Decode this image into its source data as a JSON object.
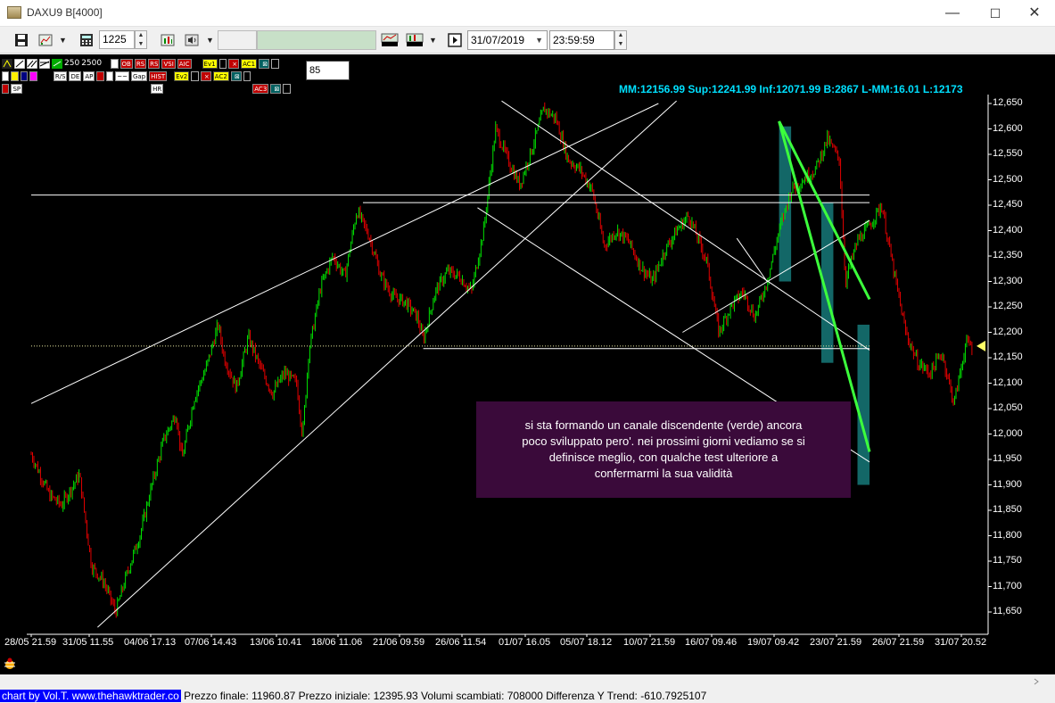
{
  "window": {
    "title": "DAXU9 B[4000]",
    "min_glyph": "—",
    "max_glyph": "☐",
    "close_glyph": "✕"
  },
  "toolbar": {
    "bars_value": "1225",
    "date_value": "31/07/2019",
    "time_value": "23:59:59",
    "save_label": "SAVE",
    "style_label": "STYLE",
    "spin_up": "▲",
    "spin_down": "▼",
    "dropdown_arrow": "▼"
  },
  "indicators": {
    "row1_scale_a": "250",
    "row1_scale_b": "2500",
    "row1": [
      "OB",
      "RS",
      "RS",
      "VSI",
      "AIC"
    ],
    "row2": [
      "R/S",
      "DE",
      "AP"
    ],
    "ev1": "Ev1",
    "ev2": "Ev2",
    "ac1": "AC1",
    "ac2": "AC2",
    "ac3": "AC3",
    "sp_label": "SP",
    "hr_label": "HR",
    "gap_label": "Gap",
    "hist_label": "HIST",
    "period_value": "85"
  },
  "info_line": "MM:12156.99 Sup:12241.99 Inf:12071.99 B:2867 L-MM:16.01 L:12173",
  "annotation": {
    "line1": "si sta formando un canale discendente (verde) ancora",
    "line2": "poco sviluppato pero'.  nei prossimi giorni vediamo se si",
    "line3": "definisce meglio, con qualche test ulteriore a",
    "line4": "confermarmi la sua validità"
  },
  "status": {
    "credit": "chart by Vol.T. www.thehawktrader.co",
    "text": " Prezzo finale: 11960.87 Prezzo iniziale: 12395.93 Volumi scambiati: 708000 Differenza Y Trend: -610.7925107"
  },
  "chart_data": {
    "type": "candlestick",
    "symbol": "DAXU9",
    "ylim": [
      11600,
      12680
    ],
    "yticks": [
      11650,
      11700,
      11750,
      11800,
      11850,
      11900,
      11950,
      12000,
      12050,
      12100,
      12150,
      12200,
      12250,
      12300,
      12350,
      12400,
      12450,
      12500,
      12550,
      12600,
      12650
    ],
    "ytick_labels": [
      "11,650",
      "11,700",
      "11,750",
      "11,800",
      "11,850",
      "11,900",
      "11,950",
      "12,000",
      "12,050",
      "12,100",
      "12,150",
      "12,200",
      "12,250",
      "12,300",
      "12,350",
      "12,400",
      "12,450",
      "12,500",
      "12,550",
      "12,600",
      "12,650"
    ],
    "xtick_labels": [
      "28/05 21.59",
      "31/05 11.55",
      "04/06 17.13",
      "07/06 14.43",
      "13/06 10.41",
      "18/06 11.06",
      "21/06 09.59",
      "26/06 11.54",
      "01/07 16.05",
      "05/07 18.12",
      "10/07 21.59",
      "16/07 09.46",
      "19/07 09.42",
      "23/07 21.59",
      "26/07 21.59",
      "31/07 20.52"
    ],
    "price_path": [
      [
        0,
        11960
      ],
      [
        3,
        11880
      ],
      [
        5,
        11860
      ],
      [
        8,
        11920
      ],
      [
        10,
        11740
      ],
      [
        12,
        11710
      ],
      [
        14,
        11650
      ],
      [
        16,
        11730
      ],
      [
        18,
        11800
      ],
      [
        20,
        11900
      ],
      [
        22,
        11990
      ],
      [
        24,
        12040
      ],
      [
        25,
        11950
      ],
      [
        27,
        12070
      ],
      [
        29,
        12130
      ],
      [
        31,
        12215
      ],
      [
        32,
        12150
      ],
      [
        34,
        12090
      ],
      [
        36,
        12190
      ],
      [
        38,
        12130
      ],
      [
        40,
        12080
      ],
      [
        42,
        12120
      ],
      [
        44,
        12100
      ],
      [
        45,
        11995
      ],
      [
        46,
        12160
      ],
      [
        48,
        12290
      ],
      [
        50,
        12350
      ],
      [
        52,
        12310
      ],
      [
        54,
        12440
      ],
      [
        56,
        12390
      ],
      [
        58,
        12310
      ],
      [
        60,
        12270
      ],
      [
        62,
        12260
      ],
      [
        64,
        12230
      ],
      [
        65,
        12185
      ],
      [
        67,
        12280
      ],
      [
        69,
        12320
      ],
      [
        71,
        12310
      ],
      [
        73,
        12280
      ],
      [
        75,
        12400
      ],
      [
        77,
        12600
      ],
      [
        79,
        12540
      ],
      [
        81,
        12490
      ],
      [
        83,
        12560
      ],
      [
        85,
        12640
      ],
      [
        87,
        12620
      ],
      [
        89,
        12540
      ],
      [
        91,
        12520
      ],
      [
        93,
        12480
      ],
      [
        95,
        12370
      ],
      [
        97,
        12400
      ],
      [
        99,
        12380
      ],
      [
        101,
        12330
      ],
      [
        103,
        12300
      ],
      [
        105,
        12360
      ],
      [
        107,
        12400
      ],
      [
        109,
        12430
      ],
      [
        110,
        12400
      ],
      [
        112,
        12340
      ],
      [
        114,
        12200
      ],
      [
        116,
        12250
      ],
      [
        118,
        12280
      ],
      [
        120,
        12230
      ],
      [
        122,
        12300
      ],
      [
        124,
        12400
      ],
      [
        126,
        12480
      ],
      [
        128,
        12500
      ],
      [
        130,
        12520
      ],
      [
        132,
        12580
      ],
      [
        134,
        12540
      ],
      [
        135,
        12300
      ],
      [
        137,
        12380
      ],
      [
        139,
        12410
      ],
      [
        141,
        12450
      ],
      [
        143,
        12320
      ],
      [
        145,
        12200
      ],
      [
        147,
        12140
      ],
      [
        149,
        12120
      ],
      [
        151,
        12160
      ],
      [
        153,
        12060
      ],
      [
        155,
        12180
      ],
      [
        156,
        12173
      ]
    ],
    "annotation_lines": [
      {
        "name": "white-trendline",
        "points": [
          [
            0,
            12060
          ],
          [
            104,
            12650
          ]
        ]
      },
      {
        "name": "white-trendline",
        "points": [
          [
            11,
            11620
          ],
          [
            107,
            12655
          ]
        ]
      },
      {
        "name": "white-trendline",
        "points": [
          [
            74,
            12445
          ],
          [
            139,
            11945
          ]
        ]
      },
      {
        "name": "white-trendline",
        "points": [
          [
            78,
            12655
          ],
          [
            139,
            12165
          ]
        ]
      },
      {
        "name": "white-trendline",
        "points": [
          [
            108,
            12200
          ],
          [
            139,
            12420
          ]
        ]
      },
      {
        "name": "white-trendline",
        "points": [
          [
            117,
            12385
          ],
          [
            122,
            12300
          ]
        ]
      },
      {
        "name": "horizontal-level",
        "points": [
          [
            0,
            12470
          ],
          [
            139,
            12470
          ]
        ]
      },
      {
        "name": "horizontal-level",
        "points": [
          [
            55,
            12455
          ],
          [
            139,
            12455
          ]
        ]
      },
      {
        "name": "horizontal-level",
        "points": [
          [
            65,
            12168
          ],
          [
            139,
            12168
          ]
        ]
      },
      {
        "name": "last-price-dotted-line",
        "points": [
          [
            0,
            12173
          ],
          [
            139,
            12173
          ]
        ]
      },
      {
        "name": "green-channel-line",
        "points": [
          [
            124,
            12615
          ],
          [
            139,
            12265
          ]
        ]
      },
      {
        "name": "green-channel-line",
        "points": [
          [
            124,
            12615
          ],
          [
            139,
            11965
          ]
        ]
      }
    ],
    "highlight_boxes": [
      {
        "x0": 124,
        "x1": 126,
        "y0": 12300,
        "y1": 12605
      },
      {
        "x0": 131,
        "x1": 133,
        "y0": 12140,
        "y1": 12455
      },
      {
        "x0": 137,
        "x1": 139,
        "y0": 11900,
        "y1": 12215
      }
    ],
    "last_price": 12173
  }
}
